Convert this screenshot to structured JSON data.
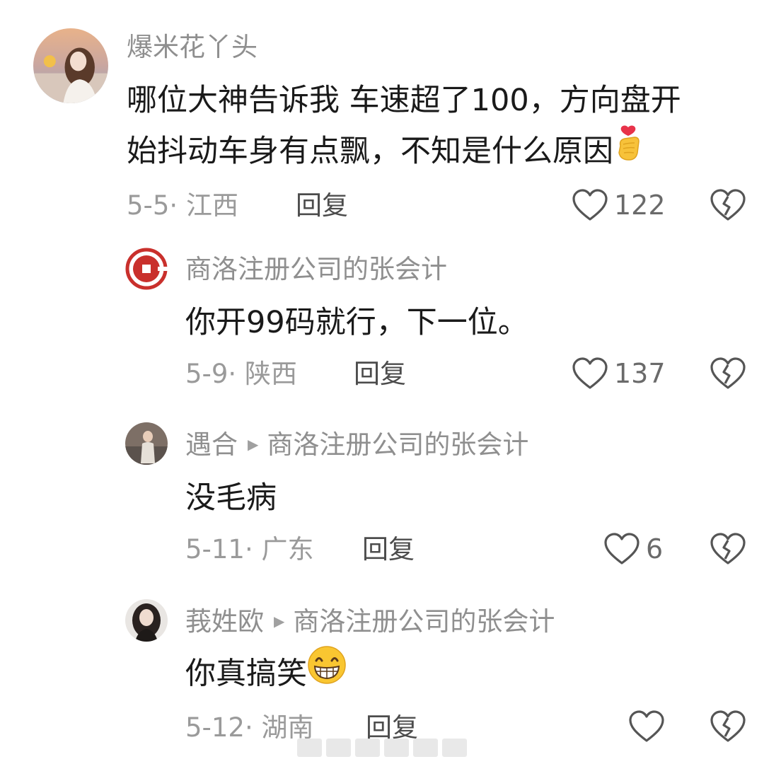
{
  "comments": [
    {
      "username": "爆米花丫头",
      "reply_to": "",
      "text_lines": [
        "哪位大神告诉我 车速超了100，方向盘开",
        "始抖动车身有点飘，不知是什么原因"
      ],
      "emoji": "finger-heart-emoji",
      "date_location": "5-5· 江西",
      "reply_label": "回复",
      "likes": "122"
    },
    {
      "username": "商洛注册公司的张会计",
      "reply_to": "",
      "text_lines": [
        "你开99码就行，下一位。"
      ],
      "date_location": "5-9· 陕西",
      "reply_label": "回复",
      "likes": "137"
    },
    {
      "username": "遇合",
      "reply_to": "商洛注册公司的张会计",
      "text_lines": [
        "没毛病"
      ],
      "date_location": "5-11· 广东",
      "reply_label": "回复",
      "likes": "6"
    },
    {
      "username": "莪姓欧",
      "reply_to": "商洛注册公司的张会计",
      "text_lines": [
        "你真搞笑"
      ],
      "emoji": "grinning-emoji",
      "date_location": "5-12· 湖南",
      "reply_label": "回复",
      "likes": ""
    }
  ],
  "icons": {
    "like": "heart-outline-icon",
    "dislike": "broken-heart-icon",
    "reply_arrow": "play-triangle-icon"
  },
  "colors": {
    "username": "#8f8f8f",
    "text": "#1a1a1a",
    "meta": "#9a9a9a",
    "icon": "#555555"
  }
}
